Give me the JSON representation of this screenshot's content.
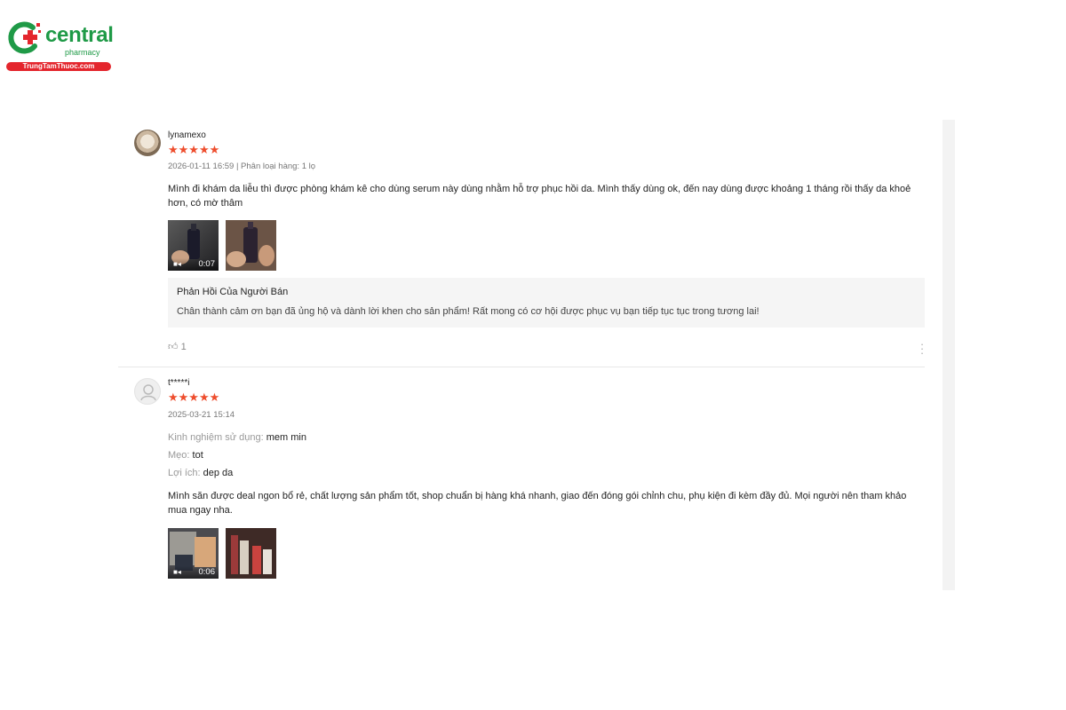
{
  "brand": {
    "name": "central",
    "sub": "pharmacy",
    "domain": "TrungTamThuoc.com",
    "green": "#1f9a47",
    "red": "#e4262d"
  },
  "reviews": [
    {
      "username": "lynamexo",
      "rating": 5,
      "stars": "★★★★★",
      "meta": "2026-01-11 16:59 | Phân loại hàng: 1 lọ",
      "text": "Mình đi khám da liễu thì được phòng khám kê cho dùng serum này dùng nhằm hỗ trợ phục hồi da. Mình thấy dùng ok, đến nay dùng được khoảng 1 tháng rồi thấy da khoẻ hơn, có mờ thâm",
      "media": [
        {
          "type": "video",
          "duration": "0:07"
        },
        {
          "type": "image"
        }
      ],
      "seller_reply": {
        "title": "Phản Hồi Của Người Bán",
        "text": "Chân thành cảm ơn bạn đã ủng hộ và dành lời khen cho sản phẩm! Rất mong có cơ hội được phục vụ bạn tiếp tục tục trong tương lai!"
      },
      "likes": "1"
    },
    {
      "username": "t*****i",
      "rating": 5,
      "stars": "★★★★★",
      "meta": "2025-03-21 15:14",
      "details": [
        {
          "label": "Kinh nghiệm sử dụng:",
          "value": "mem min"
        },
        {
          "label": "Mẹo:",
          "value": "tot"
        },
        {
          "label": "Lợi ích:",
          "value": "dep da"
        }
      ],
      "text": "Mình săn được deal ngon bổ rẻ, chất lượng sản phẩm tốt, shop chuẩn bị hàng khá nhanh, giao đến đóng gói chỉnh chu, phụ kiện đi kèm đầy đủ. Mọi người nên tham khảo mua ngay nha.",
      "media": [
        {
          "type": "video",
          "duration": "0:06"
        },
        {
          "type": "image"
        }
      ]
    }
  ],
  "colors": {
    "star": "#ee4d2d",
    "seller_box": "#f5f5f5",
    "meta": "#777777"
  }
}
